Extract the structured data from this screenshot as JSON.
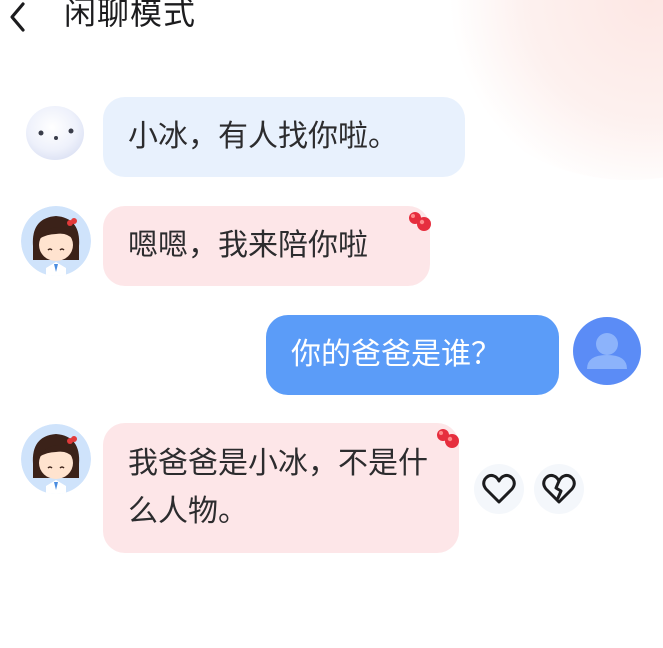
{
  "header": {
    "title": "闲聊模式",
    "back_icon": "chevron-left-icon"
  },
  "messages": [
    {
      "from": "bot",
      "avatar": "xiaobing-avatar",
      "text": "小冰，有人找你啦。"
    },
    {
      "from": "character",
      "avatar": "girl-avatar",
      "text": "嗯嗯，我来陪你啦"
    },
    {
      "from": "user",
      "avatar": "user-avatar",
      "text": "你的爸爸是谁？"
    },
    {
      "from": "character",
      "avatar": "girl-avatar",
      "text": "我爸爸是小冰，不是什么人物。"
    }
  ],
  "reactions": {
    "like_icon": "heart-outline-icon",
    "dislike_icon": "broken-heart-icon"
  },
  "colors": {
    "bot_bubble": "#e8f1fd",
    "character_bubble": "#fde6e8",
    "user_bubble": "#5b9cf8",
    "user_avatar": "#5b8cf6"
  }
}
